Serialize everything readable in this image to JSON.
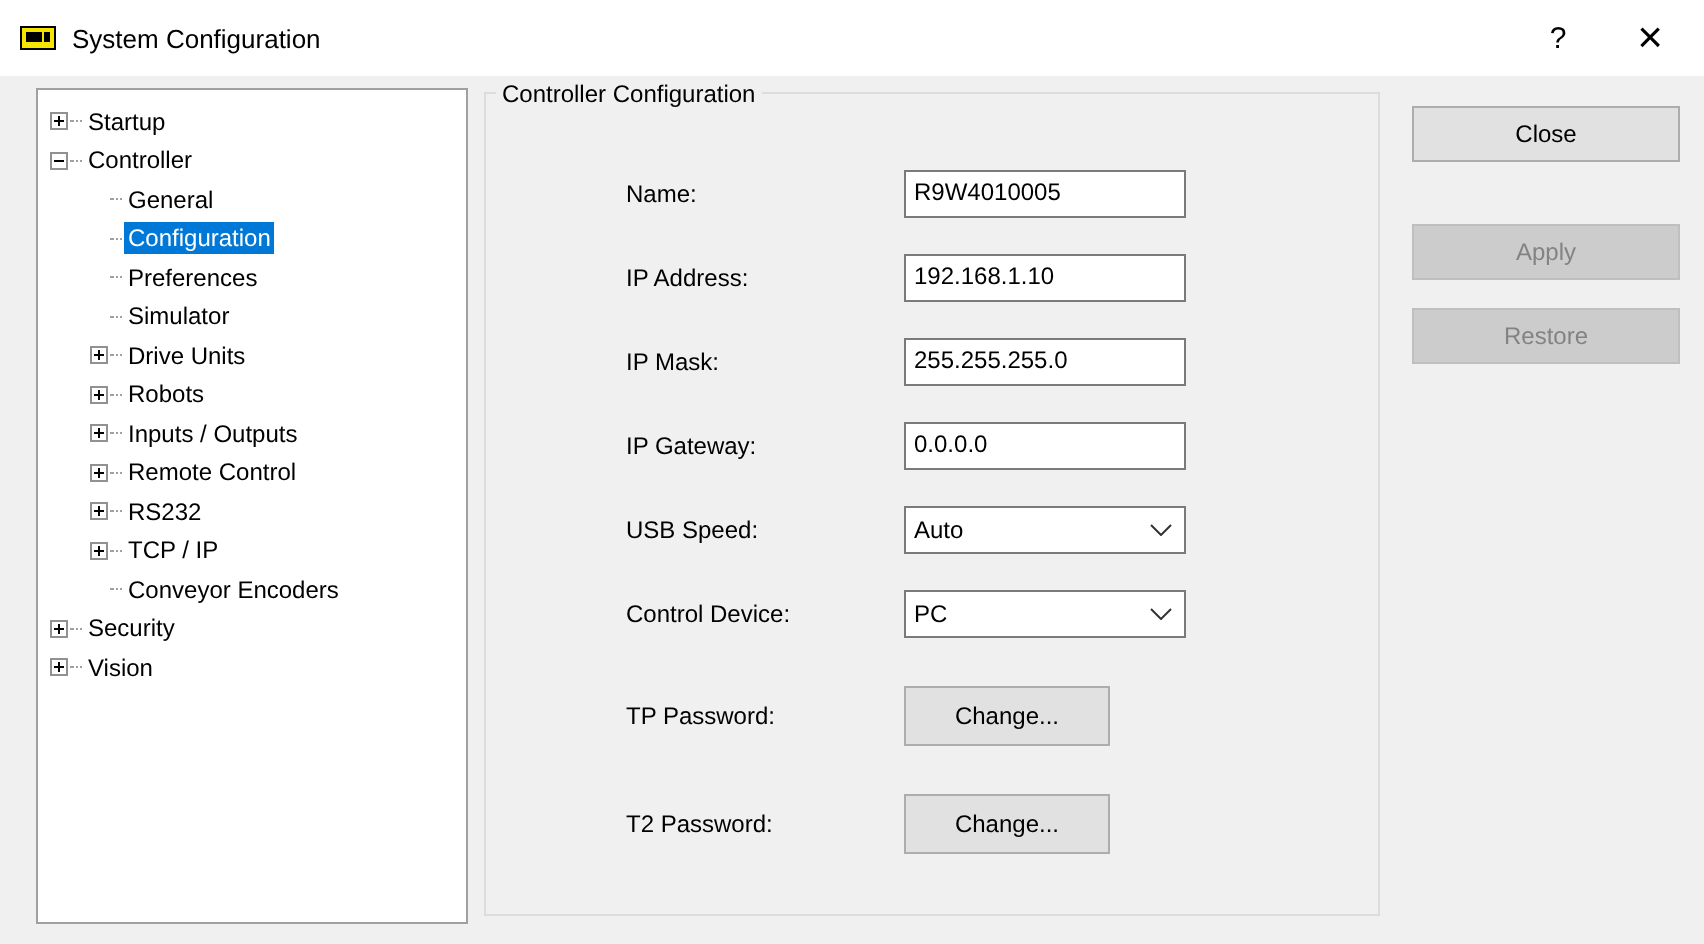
{
  "window": {
    "title": "System Configuration",
    "help": "?",
    "close": "×"
  },
  "tree": [
    {
      "label": "Startup",
      "expanded": false,
      "selected": false
    },
    {
      "label": "Controller",
      "expanded": true,
      "selected": false,
      "children": [
        {
          "label": "General",
          "selected": false
        },
        {
          "label": "Configuration",
          "selected": true
        },
        {
          "label": "Preferences",
          "selected": false
        },
        {
          "label": "Simulator",
          "selected": false
        },
        {
          "label": "Drive Units",
          "selected": false,
          "expanded": false
        },
        {
          "label": "Robots",
          "selected": false,
          "expanded": false
        },
        {
          "label": "Inputs / Outputs",
          "selected": false,
          "expanded": false
        },
        {
          "label": "Remote Control",
          "selected": false,
          "expanded": false
        },
        {
          "label": "RS232",
          "selected": false,
          "expanded": false
        },
        {
          "label": "TCP / IP",
          "selected": false,
          "expanded": false
        },
        {
          "label": "Conveyor Encoders",
          "selected": false
        }
      ]
    },
    {
      "label": "Security",
      "expanded": false,
      "selected": false
    },
    {
      "label": "Vision",
      "expanded": false,
      "selected": false
    }
  ],
  "group": {
    "title": "Controller Configuration",
    "fields": [
      {
        "kind": "text",
        "label": "Name:",
        "value": "R9W4010005"
      },
      {
        "kind": "text",
        "label": "IP Address:",
        "value": "192.168.1.10"
      },
      {
        "kind": "text",
        "label": "IP Mask:",
        "value": "255.255.255.0"
      },
      {
        "kind": "text",
        "label": "IP Gateway:",
        "value": "0.0.0.0"
      },
      {
        "kind": "combo",
        "label": "USB Speed:",
        "value": "Auto"
      },
      {
        "kind": "combo",
        "label": "Control Device:",
        "value": "PC"
      },
      {
        "kind": "button",
        "label": "TP Password:",
        "value": "Change..."
      },
      {
        "kind": "button",
        "label": "T2 Password:",
        "value": "Change..."
      }
    ]
  },
  "buttons": [
    {
      "label": "Close",
      "disabled": false
    },
    {
      "label": "Apply",
      "disabled": true
    },
    {
      "label": "Restore",
      "disabled": true
    }
  ]
}
